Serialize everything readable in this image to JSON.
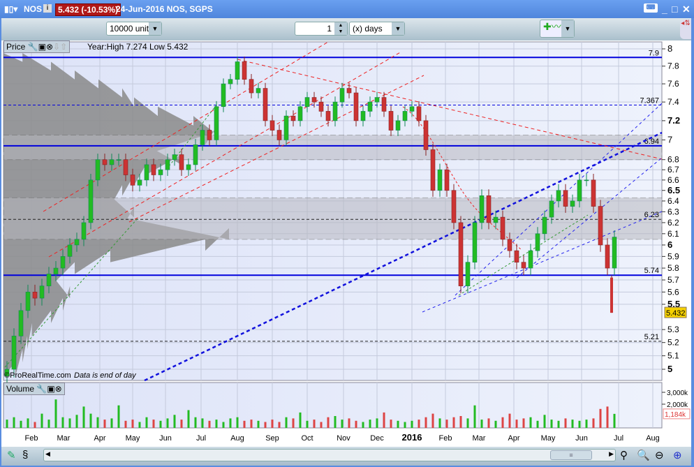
{
  "titlebar": {
    "ticker": "NOS",
    "price_change": "5.432 (-10.53%)",
    "date_name": "24-Jun-2016  NOS, SGPS",
    "info": "i"
  },
  "toolbar": {
    "units": "10000 units",
    "period_value": "1",
    "period_unit": "(x) days"
  },
  "price_panel": {
    "label": "Price",
    "year_info": "Year:High 7.274 Low 5.432",
    "copyright": "©ProRealTime.com",
    "note": "Data is end of day"
  },
  "volume_panel": {
    "label": "Volume"
  },
  "colors": {
    "up": "#22bb22",
    "down": "#cc3333",
    "level": "#0000dd",
    "bg": "#e6eafa"
  },
  "chart_data": {
    "type": "candlestick",
    "title": "NOS, SGPS",
    "sampling": "approx. weekly, Jan 2015 – 24 Jun 2016",
    "y_scale": "log",
    "ylim": [
      4.95,
      8.05
    ],
    "y_ticks": [
      "8",
      "7.8",
      "7.6",
      "7.4",
      "7.2",
      "7",
      "6.8",
      "6.7",
      "6.6",
      "6.5",
      "6.4",
      "6.3",
      "6.2",
      "6.1",
      "6",
      "5.9",
      "5.8",
      "5.7",
      "5.6",
      "5.5",
      "5.3",
      "5.2",
      "5.1",
      "5"
    ],
    "x_ticks": [
      "Feb",
      "Mar",
      "Apr",
      "May",
      "Jun",
      "Jul",
      "Aug",
      "Sep",
      "Oct",
      "Nov",
      "Dec",
      "2016",
      "Feb",
      "Mar",
      "Apr",
      "May",
      "Jun",
      "Jul",
      "Aug"
    ],
    "closes": [
      5.0,
      5.25,
      5.45,
      5.6,
      5.55,
      5.65,
      5.75,
      5.8,
      5.9,
      6.0,
      6.05,
      6.2,
      6.6,
      6.8,
      6.75,
      6.8,
      6.8,
      6.65,
      6.55,
      6.6,
      6.75,
      6.65,
      6.7,
      6.8,
      6.85,
      6.7,
      6.75,
      6.95,
      7.1,
      7.0,
      7.35,
      7.6,
      7.65,
      7.85,
      7.65,
      7.5,
      7.55,
      7.2,
      7.1,
      7.0,
      7.25,
      7.2,
      7.35,
      7.45,
      7.4,
      7.3,
      7.2,
      7.4,
      7.55,
      7.5,
      7.2,
      7.3,
      7.4,
      7.45,
      7.3,
      7.1,
      7.2,
      7.3,
      7.35,
      7.2,
      6.9,
      6.5,
      6.7,
      6.5,
      6.2,
      5.65,
      5.85,
      6.2,
      6.45,
      6.2,
      6.25,
      6.05,
      5.95,
      5.85,
      5.8,
      5.95,
      6.1,
      6.25,
      6.4,
      6.5,
      6.35,
      6.4,
      6.6,
      6.6,
      6.35,
      6.0,
      5.8,
      6.07
    ],
    "last_candle": {
      "open": 5.72,
      "high": 5.74,
      "low": 5.432,
      "close": 5.432
    },
    "last_price": "5.432",
    "levels": [
      {
        "value": 7.9,
        "label": "7.9",
        "style": "solid"
      },
      {
        "value": 7.367,
        "label": "7.367",
        "style": "dashed"
      },
      {
        "value": 6.94,
        "label": "6.94",
        "style": "solid"
      },
      {
        "value": 6.23,
        "label": "6.23",
        "style": "dashed-black"
      },
      {
        "value": 5.74,
        "label": "5.74",
        "style": "solid"
      },
      {
        "value": 5.21,
        "label": "5.21",
        "style": "dashed-black"
      }
    ],
    "zones": [
      [
        6.8,
        7.05
      ],
      [
        6.05,
        6.43
      ]
    ],
    "volume_profile": {
      "prices": [
        5.0,
        5.1,
        5.2,
        5.3,
        5.4,
        5.5,
        5.6,
        5.7,
        5.8,
        5.9,
        6.0,
        6.1,
        6.2,
        6.3,
        6.4,
        6.5,
        6.6,
        6.7,
        6.8,
        6.9,
        7.0,
        7.1,
        7.2,
        7.3,
        7.4,
        7.5,
        7.6,
        7.7,
        7.8,
        7.9
      ],
      "relative": [
        0.05,
        0.08,
        0.1,
        0.12,
        0.2,
        0.25,
        0.28,
        0.2,
        0.3,
        0.45,
        0.85,
        0.95,
        0.5,
        0.55,
        0.45,
        0.5,
        0.55,
        0.6,
        0.75,
        0.6,
        0.85,
        0.9,
        0.8,
        0.65,
        0.55,
        0.5,
        0.4,
        0.3,
        0.2,
        0.08
      ]
    },
    "volume": {
      "unit": "k",
      "ticks": [
        "3,000k",
        "2,000k"
      ],
      "last": "1,184k",
      "values": [
        700,
        900,
        600,
        800,
        500,
        1200,
        700,
        2400,
        900,
        800,
        1100,
        1800,
        1200,
        900,
        700,
        800,
        1900,
        600,
        700,
        500,
        900,
        700,
        600,
        800,
        1100,
        700,
        1500,
        900,
        800,
        600,
        700,
        500,
        800,
        900,
        600,
        700,
        600,
        500,
        700,
        500,
        900,
        800,
        1300,
        600,
        700,
        500,
        900,
        1000,
        700,
        800,
        600,
        500,
        700,
        800,
        1300,
        700,
        600,
        500,
        600,
        700,
        900,
        1200,
        800,
        700,
        900,
        1000,
        800,
        1900,
        700,
        800,
        600,
        900,
        1200,
        700,
        800,
        900,
        600,
        1100,
        700,
        600,
        800,
        700,
        600,
        700,
        800,
        1600,
        1800,
        1184
      ]
    }
  }
}
